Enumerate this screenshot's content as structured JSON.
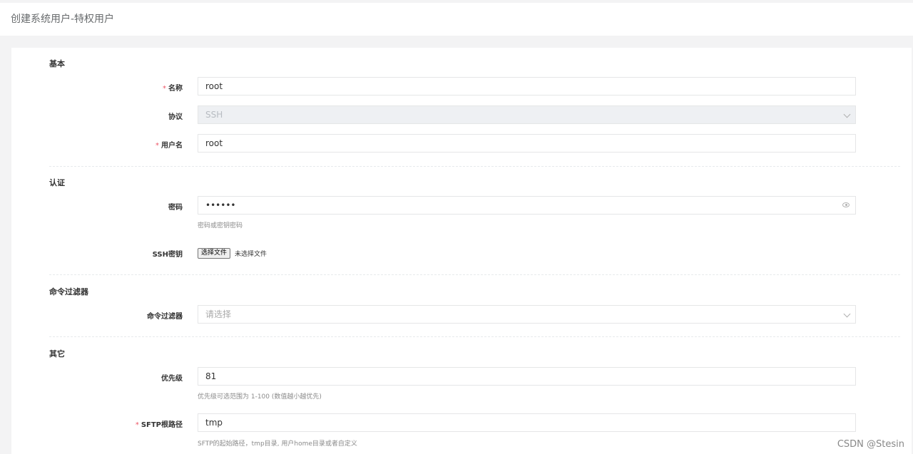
{
  "page": {
    "title": "创建系统用户-特权用户"
  },
  "sections": {
    "basic": "基本",
    "auth": "认证",
    "cmd_filter": "命令过滤器",
    "other": "其它"
  },
  "fields": {
    "name": {
      "label": "名称",
      "required": "*",
      "value": "root"
    },
    "protocol": {
      "label": "协议",
      "value": "SSH"
    },
    "username": {
      "label": "用户名",
      "required": "*",
      "value": "root"
    },
    "password": {
      "label": "密码",
      "value": "••••••",
      "help": "密码或密钥密码"
    },
    "ssh_key": {
      "label": "SSH密钥",
      "button": "选择文件",
      "status": "未选择文件"
    },
    "cmd_filter": {
      "label": "命令过滤器",
      "placeholder": "请选择"
    },
    "priority": {
      "label": "优先级",
      "value": "81",
      "help": "优先级可选范围为 1-100 (数值越小越优先)"
    },
    "sftp_root": {
      "label": "SFTP根路径",
      "required": "*",
      "value": "tmp",
      "help": "SFTP的起始路径，tmp目录, 用户home目录或者自定义"
    }
  },
  "watermark": "CSDN @Stesin",
  "icons": {
    "select": "chevron-down-icon",
    "password_toggle": "eye-icon"
  }
}
